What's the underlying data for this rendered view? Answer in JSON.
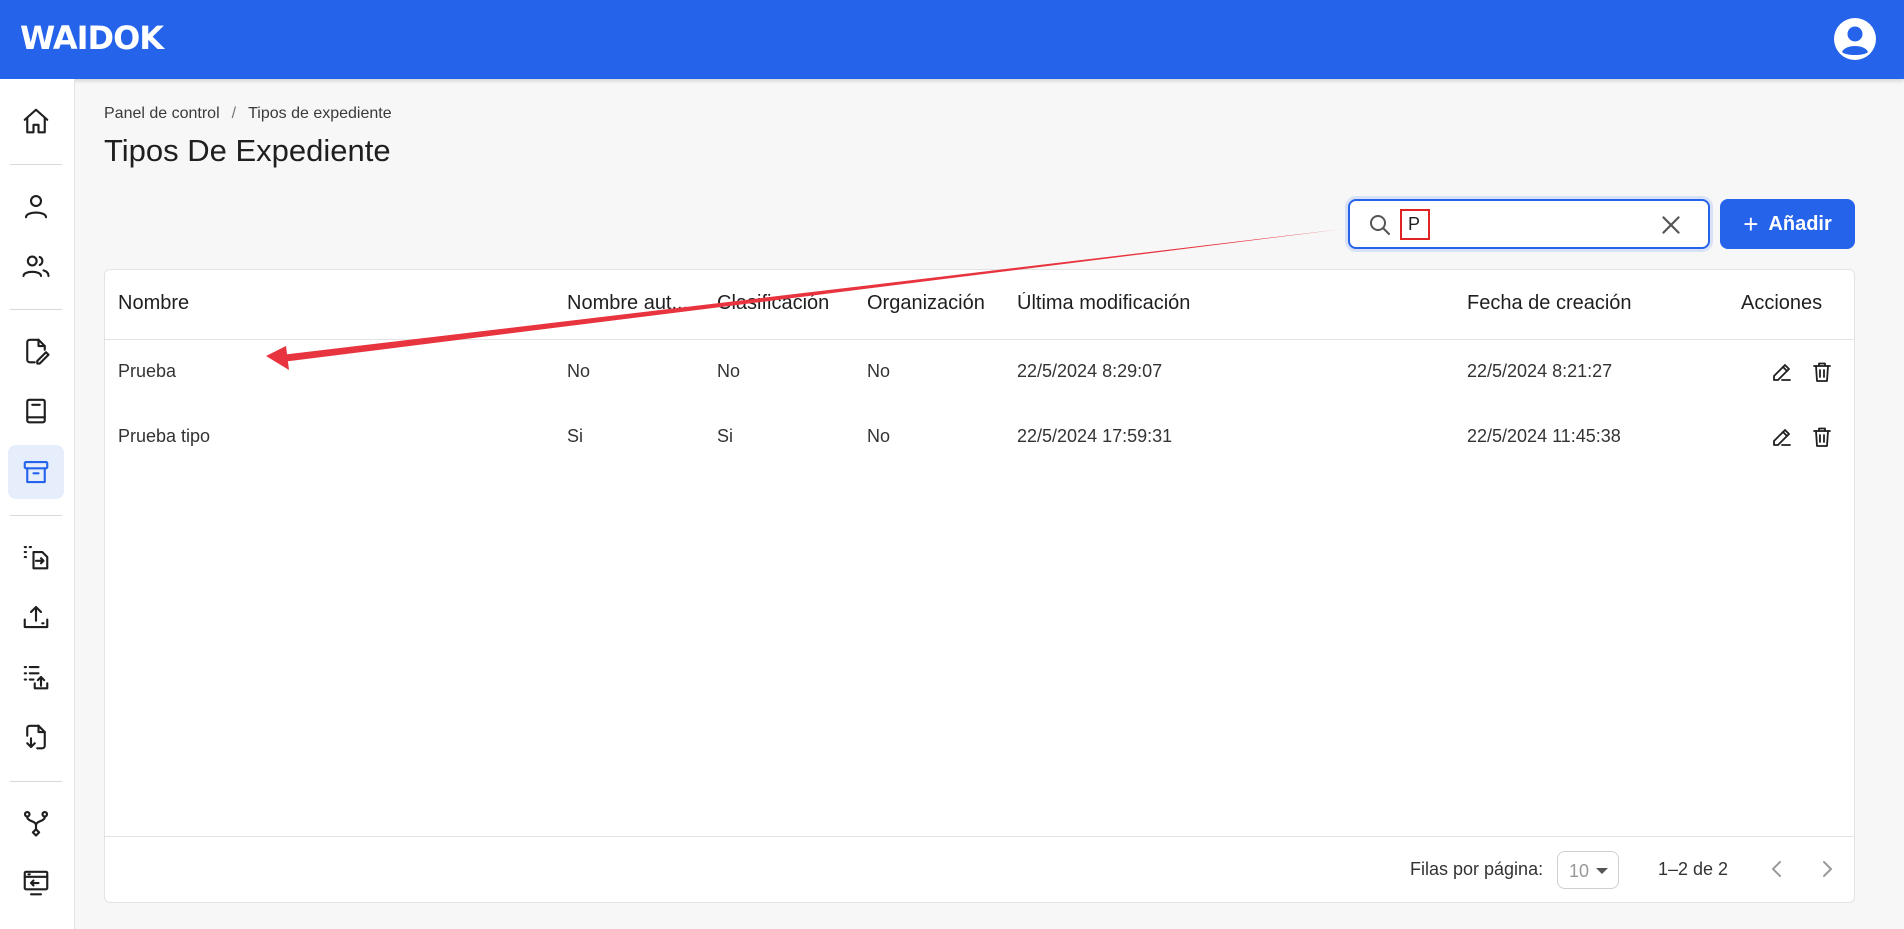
{
  "header": {
    "logo": "WAIDOK",
    "avatar_icon": "user-circle-icon"
  },
  "sidebar": {
    "items": [
      {
        "icon": "home-icon"
      },
      {
        "icon": "user-icon"
      },
      {
        "icon": "users-icon"
      },
      {
        "icon": "file-signature-icon"
      },
      {
        "icon": "book-icon"
      },
      {
        "icon": "archive-icon",
        "active": true
      },
      {
        "icon": "file-transfer-icon"
      },
      {
        "icon": "upload-icon"
      },
      {
        "icon": "list-upload-icon"
      },
      {
        "icon": "file-download-icon"
      },
      {
        "icon": "workflow-icon"
      },
      {
        "icon": "screen-import-icon"
      }
    ]
  },
  "breadcrumb": {
    "items": [
      "Panel de control",
      "Tipos de expediente"
    ],
    "separator": "/"
  },
  "page": {
    "title": "Tipos De Expediente"
  },
  "search": {
    "value": "P",
    "placeholder": ""
  },
  "toolbar": {
    "add_label": "Añadir"
  },
  "table": {
    "columns": [
      "Nombre",
      "Nombre aut...",
      "Clasificación",
      "Organización",
      "Última modificación",
      "Fecha de creación",
      "Acciones"
    ],
    "rows": [
      [
        "Prueba",
        "No",
        "No",
        "No",
        "22/5/2024 8:29:07",
        "22/5/2024 8:21:27"
      ],
      [
        "Prueba tipo",
        "Si",
        "Si",
        "No",
        "22/5/2024 17:59:31",
        "22/5/2024 11:45:38"
      ]
    ]
  },
  "pagination": {
    "rows_per_page_label": "Filas por página:",
    "rows_per_page": "10",
    "range": "1–2 de 2"
  },
  "colors": {
    "primary": "#2563eb",
    "annotation": "#e8343f"
  }
}
